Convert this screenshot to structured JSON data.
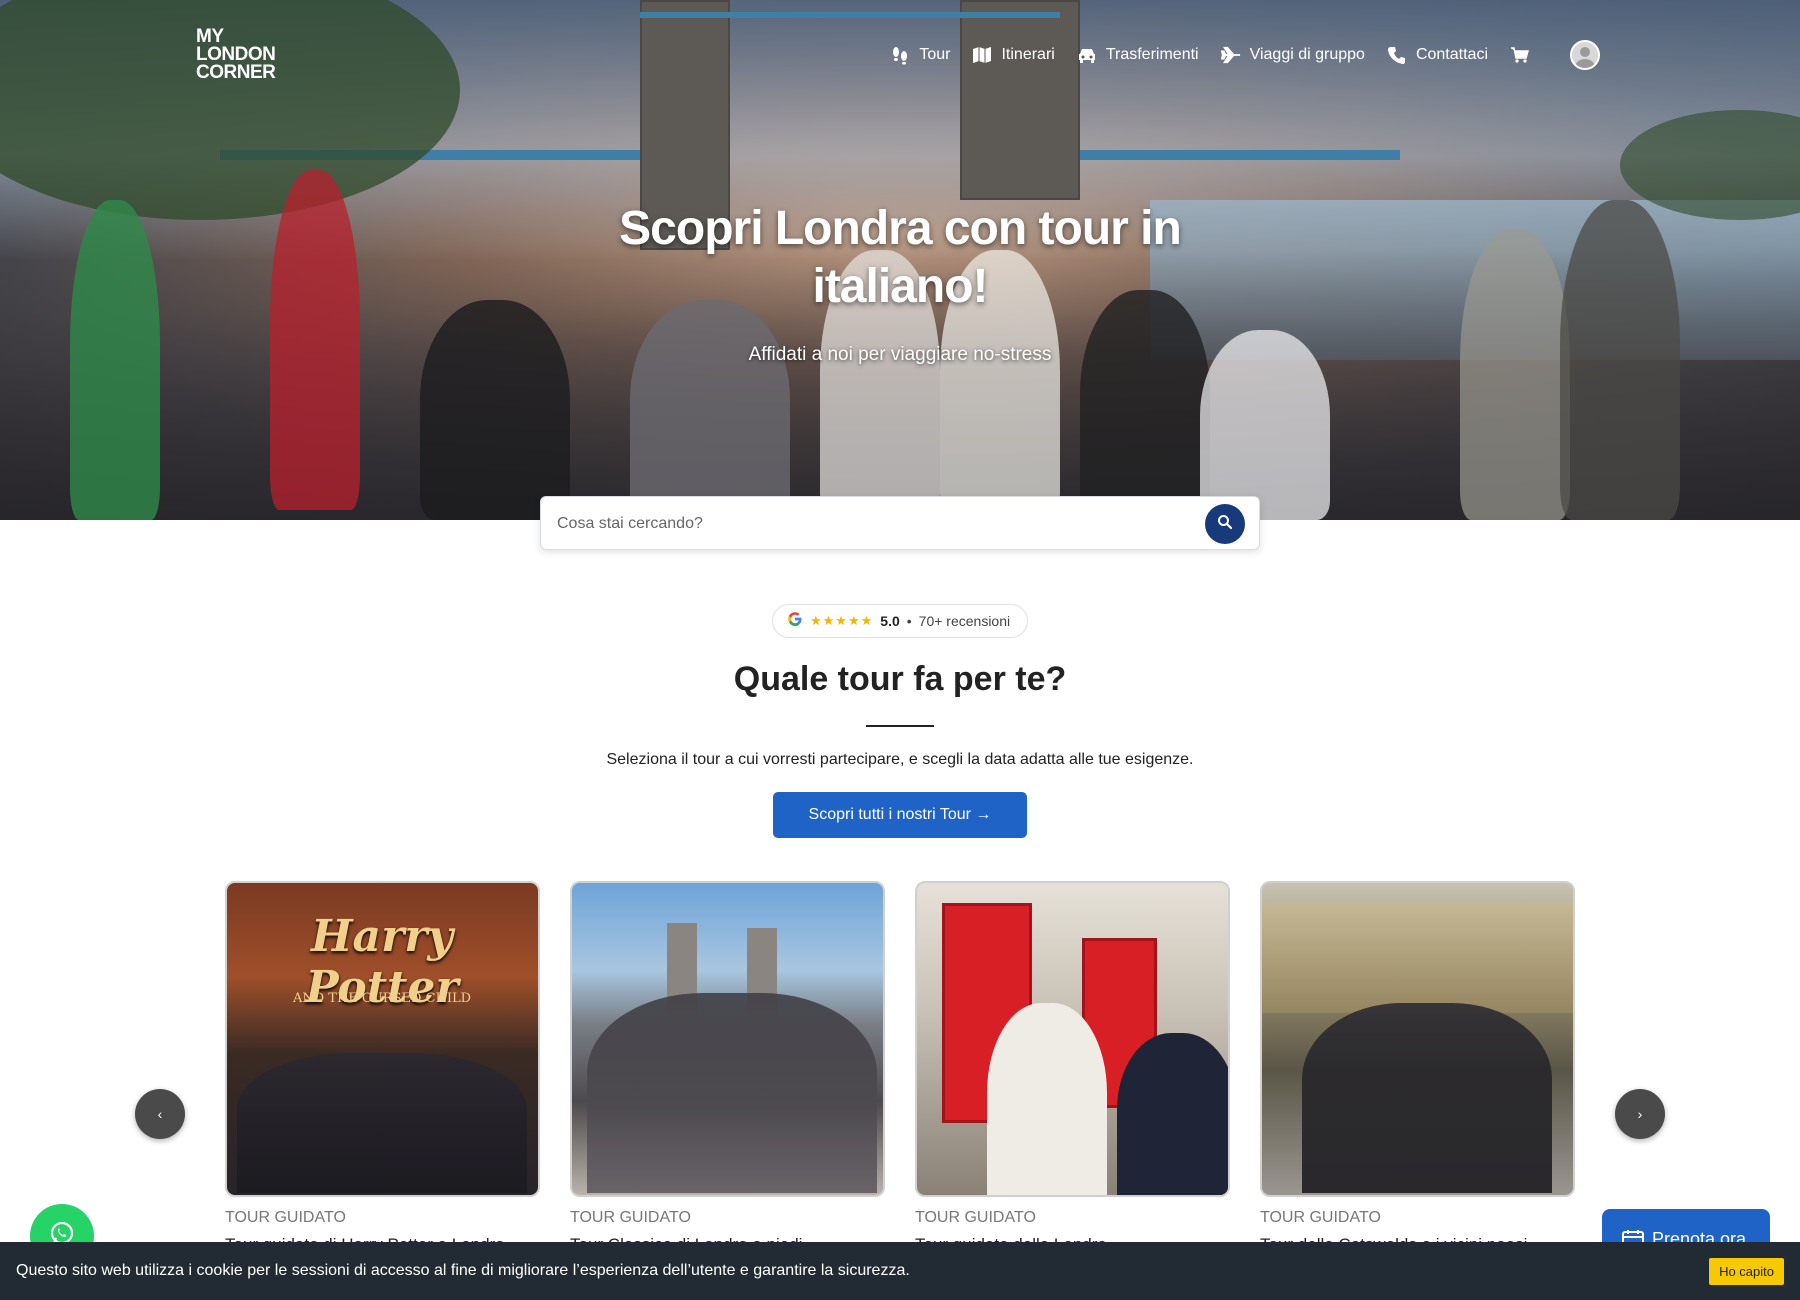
{
  "brand": {
    "logo_lines": [
      "MY",
      "LONDON",
      "CORNER"
    ]
  },
  "nav": {
    "items": [
      {
        "label": "Tour",
        "icon": "footsteps-icon"
      },
      {
        "label": "Itinerari",
        "icon": "map-icon"
      },
      {
        "label": "Trasferimenti",
        "icon": "car-icon"
      },
      {
        "label": "Viaggi di gruppo",
        "icon": "plane-icon"
      },
      {
        "label": "Contattaci",
        "icon": "phone-icon"
      }
    ],
    "cart_icon": "cart-icon",
    "account_icon": "user-avatar-icon"
  },
  "hero": {
    "title": "Scopri Londra con tour in italiano!",
    "subtitle": "Affidati a noi per viaggiare no-stress"
  },
  "search": {
    "placeholder": "Cosa stai cercando?"
  },
  "rating": {
    "stars": "★★★★★",
    "score": "5.0",
    "separator": "•",
    "reviews": "70+ recensioni"
  },
  "section": {
    "title": "Quale tour fa per te?",
    "description": "Seleziona il tour a cui vorresti partecipare, e scegli la data adatta alle tue esigenze.",
    "cta": "Scopri tutti i nostri Tour →"
  },
  "carousel": {
    "prev": "‹",
    "next": "›",
    "cards": [
      {
        "category": "TOUR GUIDATO",
        "title": "Tour guidato di Harry Potter a Londra",
        "sign_text": "Harry Potter",
        "sign_sub": "AND THE CURSED CHILD"
      },
      {
        "category": "TOUR GUIDATO",
        "title": "Tour Classico di Londra a piedi"
      },
      {
        "category": "TOUR GUIDATO",
        "title": "Tour guidato della Londra"
      },
      {
        "category": "TOUR GUIDATO",
        "title": "Tour delle Cotswolds e i vicini paesi"
      }
    ]
  },
  "floating": {
    "book_label": "Prenota ora",
    "whatsapp_icon": "whatsapp-icon"
  },
  "cookie": {
    "text": "Questo sito web utilizza i cookie per le sessioni di accesso al fine di migliorare l’esperienza dell’utente e garantire la sicurezza.",
    "button": "Ho capito"
  },
  "colors": {
    "primary": "#1f63c6",
    "search_button": "#163a7a",
    "cookie_bar": "#222a33",
    "cookie_button": "#f6c900",
    "whatsapp": "#25d366"
  }
}
